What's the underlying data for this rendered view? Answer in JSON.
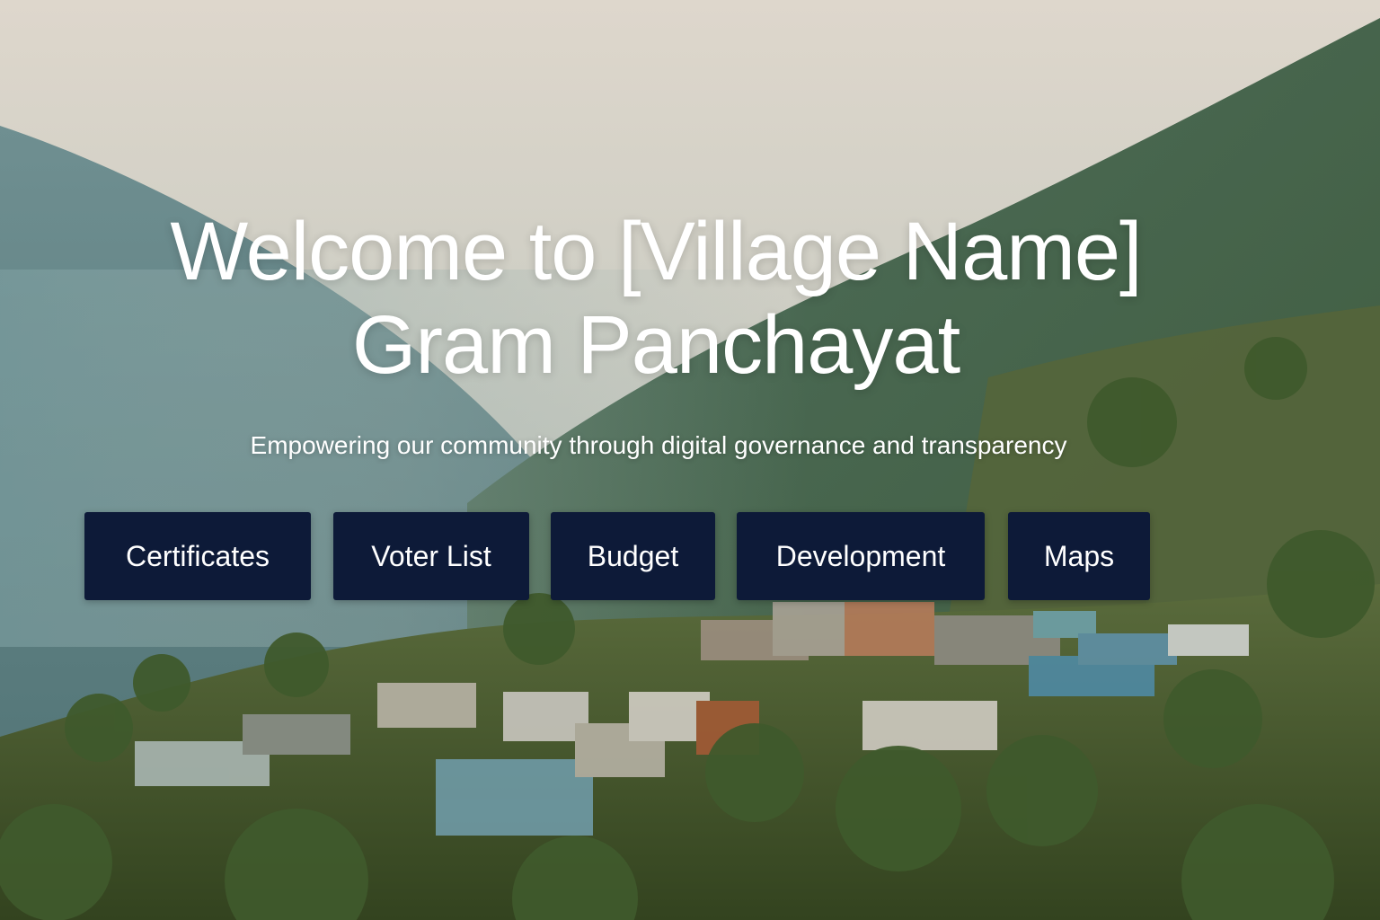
{
  "hero": {
    "title_line1": "Welcome to [Village Name]",
    "title_line2": "Gram Panchayat",
    "tagline": "Empowering our community through digital governance and transparency"
  },
  "nav": {
    "certificates": "Certificates",
    "voter_list": "Voter List",
    "budget": "Budget",
    "development": "Development",
    "maps": "Maps"
  },
  "colors": {
    "button_bg": "#0d1a38",
    "text": "#ffffff"
  }
}
